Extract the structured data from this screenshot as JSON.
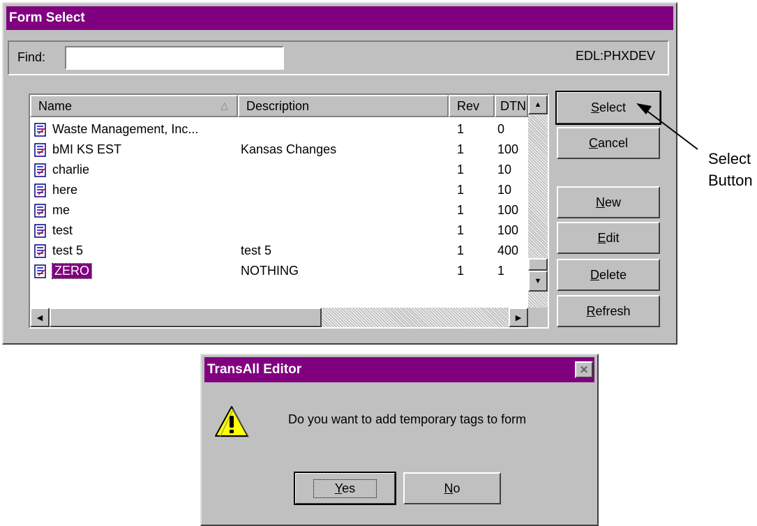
{
  "form_select": {
    "title": "Form Select",
    "find_label": "Find:",
    "find_value": "",
    "connection": "EDL:PHXDEV",
    "columns": [
      "Name",
      "Description",
      "Rev",
      "DTN"
    ],
    "rows": [
      {
        "name": "Waste Management, Inc...",
        "description": "",
        "rev": "1",
        "dtn": "0"
      },
      {
        "name": "bMI KS EST",
        "description": "Kansas Changes",
        "rev": "1",
        "dtn": "100"
      },
      {
        "name": "charlie",
        "description": "",
        "rev": "1",
        "dtn": "10"
      },
      {
        "name": "here",
        "description": "",
        "rev": "1",
        "dtn": "10"
      },
      {
        "name": "me",
        "description": "",
        "rev": "1",
        "dtn": "100"
      },
      {
        "name": "test",
        "description": "",
        "rev": "1",
        "dtn": "100"
      },
      {
        "name": "test 5",
        "description": "test 5",
        "rev": "1",
        "dtn": "400"
      },
      {
        "name": "ZERO",
        "description": "NOTHING",
        "rev": "1",
        "dtn": "1"
      }
    ],
    "selected_row": "ZERO",
    "buttons": {
      "select": "Select",
      "cancel": "Cancel",
      "new": "New",
      "edit": "Edit",
      "delete": "Delete",
      "refresh": "Refresh"
    }
  },
  "annotation": {
    "line1": "Select",
    "line2": "Button"
  },
  "dialog": {
    "title": "TransAll Editor",
    "close_icon": "close-icon",
    "warning_icon": "warning-icon",
    "message": "Do you want to add temporary tags to form",
    "yes_label": "Yes",
    "no_label": "No"
  },
  "colors": {
    "title_bar": "#800080",
    "face": "#c0c0c0",
    "selection": "#800080"
  }
}
